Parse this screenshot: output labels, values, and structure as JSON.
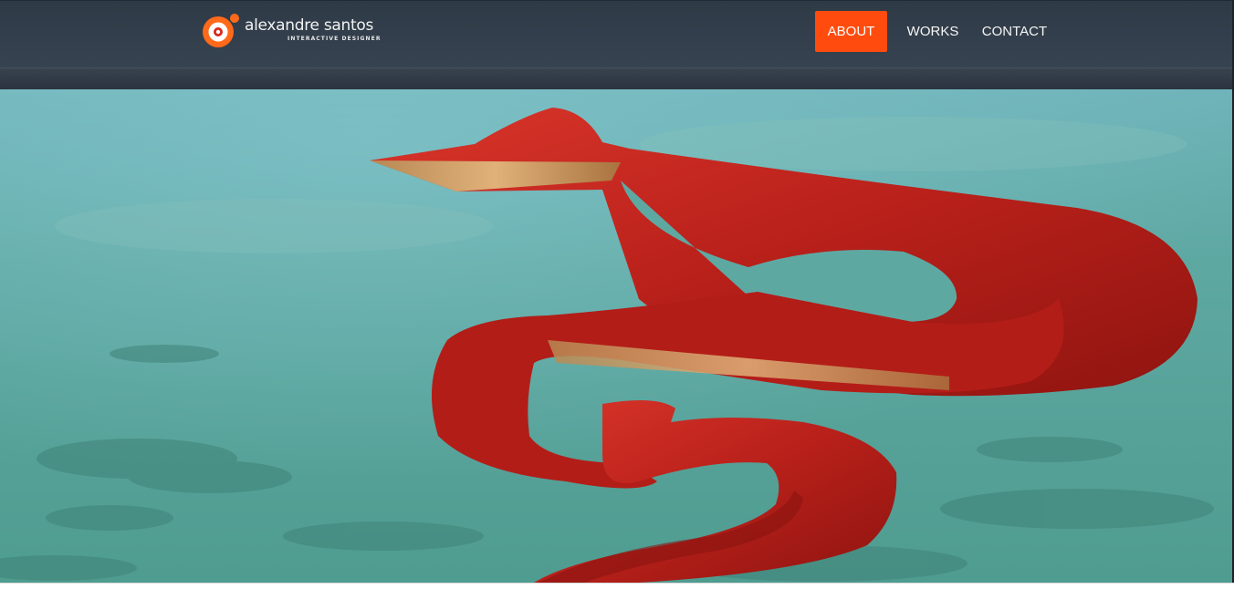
{
  "brand": {
    "name": "alexandre santos",
    "tagline": "INTERACTIVE DESIGNER",
    "accent_color": "#ff4c0e",
    "logo_icon": "target-logo-icon"
  },
  "nav": {
    "items": [
      {
        "label": "ABOUT",
        "active": true
      },
      {
        "label": "WORKS",
        "active": false
      },
      {
        "label": "CONTACT",
        "active": false
      }
    ]
  },
  "hero": {
    "image": "red-ribbon-sculpture-photo",
    "sky_color": "#5aa6a0",
    "sculpture_color": "#c4201c"
  }
}
